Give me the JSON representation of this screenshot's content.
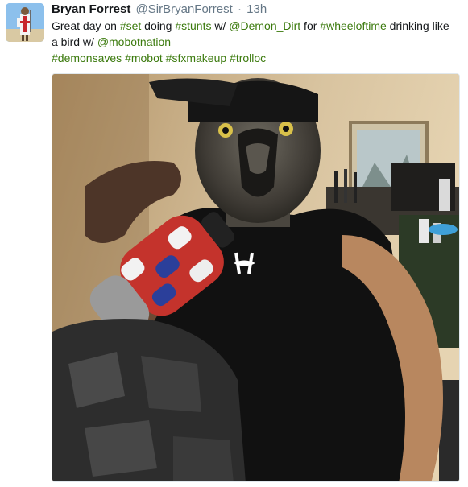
{
  "tweet": {
    "author_name": "Bryan Forrest",
    "author_handle": "@SirBryanForrest",
    "separator": "·",
    "timestamp": "13h",
    "text_lines": [
      [
        {
          "t": "Great day on ",
          "k": "text"
        },
        {
          "t": "#set",
          "k": "tag"
        },
        {
          "t": " doing ",
          "k": "text"
        },
        {
          "t": "#stunts",
          "k": "tag"
        },
        {
          "t": " w/ ",
          "k": "text"
        },
        {
          "t": "@Demon_Dirt",
          "k": "tag"
        },
        {
          "t": " for ",
          "k": "text"
        },
        {
          "t": "#wheeloftime",
          "k": "tag"
        },
        {
          "t": " drinking like",
          "k": "text"
        }
      ],
      [
        {
          "t": "a bird w/ ",
          "k": "text"
        },
        {
          "t": "@mobotnation",
          "k": "tag"
        }
      ],
      [
        {
          "t": "#demonsaves",
          "k": "tag"
        },
        {
          "t": " ",
          "k": "text"
        },
        {
          "t": "#mobot",
          "k": "tag"
        },
        {
          "t": " ",
          "k": "text"
        },
        {
          "t": "#sfxmakeup",
          "k": "tag"
        },
        {
          "t": " ",
          "k": "text"
        },
        {
          "t": "#trolloc",
          "k": "tag"
        }
      ]
    ],
    "link_color": "#3b7a0d",
    "media": {
      "shirt_logo": "under-armour-logo-icon"
    }
  }
}
